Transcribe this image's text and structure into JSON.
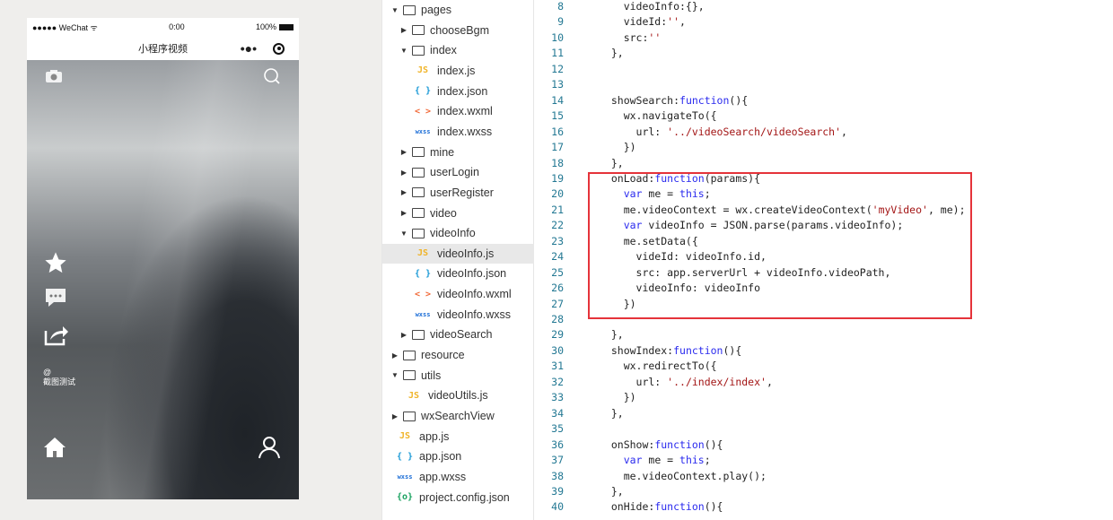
{
  "phone": {
    "status": {
      "carrier": "●●●●● WeChat",
      "wifi": "ᯤ",
      "time": "0:00",
      "battery": "100%"
    },
    "nav": {
      "title": "小程序视频",
      "more": "•●•"
    },
    "overlay": {
      "at": "@",
      "username": "截图测试"
    },
    "icons": [
      "camera-icon",
      "search-icon",
      "star-icon",
      "comment-icon",
      "share-icon",
      "home-icon",
      "user-icon"
    ]
  },
  "tree": [
    {
      "label": "pages",
      "type": "folder",
      "open": true,
      "depth": 0
    },
    {
      "label": "chooseBgm",
      "type": "folder",
      "open": false,
      "depth": 1
    },
    {
      "label": "index",
      "type": "folder",
      "open": true,
      "depth": 1
    },
    {
      "label": "index.js",
      "type": "js",
      "depth": 2
    },
    {
      "label": "index.json",
      "type": "json",
      "depth": 2
    },
    {
      "label": "index.wxml",
      "type": "wxml",
      "depth": 2
    },
    {
      "label": "index.wxss",
      "type": "wxss",
      "depth": 2
    },
    {
      "label": "mine",
      "type": "folder",
      "open": false,
      "depth": 1
    },
    {
      "label": "userLogin",
      "type": "folder",
      "open": false,
      "depth": 1
    },
    {
      "label": "userRegister",
      "type": "folder",
      "open": false,
      "depth": 1
    },
    {
      "label": "video",
      "type": "folder",
      "open": false,
      "depth": 1
    },
    {
      "label": "videoInfo",
      "type": "folder",
      "open": true,
      "depth": 1
    },
    {
      "label": "videoInfo.js",
      "type": "js",
      "depth": 2,
      "selected": true
    },
    {
      "label": "videoInfo.json",
      "type": "json",
      "depth": 2
    },
    {
      "label": "videoInfo.wxml",
      "type": "wxml",
      "depth": 2
    },
    {
      "label": "videoInfo.wxss",
      "type": "wxss",
      "depth": 2
    },
    {
      "label": "videoSearch",
      "type": "folder",
      "open": false,
      "depth": 1
    },
    {
      "label": "resource",
      "type": "folder",
      "open": false,
      "depth": 0
    },
    {
      "label": "utils",
      "type": "folder",
      "open": true,
      "depth": 0
    },
    {
      "label": "videoUtils.js",
      "type": "js",
      "depth": 1
    },
    {
      "label": "wxSearchView",
      "type": "folder",
      "open": false,
      "depth": 0
    },
    {
      "label": "app.js",
      "type": "js",
      "depth": 0
    },
    {
      "label": "app.json",
      "type": "json",
      "depth": 0
    },
    {
      "label": "app.wxss",
      "type": "wxss",
      "depth": 0
    },
    {
      "label": "project.config.json",
      "type": "config",
      "depth": 0
    }
  ],
  "icon_glyphs": {
    "js": "JS",
    "json": "{ }",
    "wxml": "< >",
    "wxss": "wxss",
    "config": "{o}"
  },
  "icon_colors": {
    "js": "#f0b429",
    "json": "#1e9bd7",
    "wxml": "#f26b3a",
    "wxss": "#1e6fd7",
    "config": "#1aa260"
  },
  "highlight": {
    "from_line": 19,
    "to_line": 27,
    "color": "#e5333a"
  },
  "code": [
    {
      "n": "8",
      "t": [
        [
          "    videoInfo:{},",
          ""
        ]
      ]
    },
    {
      "n": "9",
      "t": [
        [
          "    videId:",
          ""
        ],
        [
          "''",
          "str"
        ],
        [
          ",",
          ""
        ]
      ]
    },
    {
      "n": "10",
      "t": [
        [
          "    src:",
          ""
        ],
        [
          "''",
          "str"
        ]
      ]
    },
    {
      "n": "11",
      "t": [
        [
          "  },",
          ""
        ]
      ]
    },
    {
      "n": "12",
      "t": []
    },
    {
      "n": "13",
      "t": []
    },
    {
      "n": "14",
      "t": [
        [
          "  showSearch:",
          ""
        ],
        [
          "function",
          "kw"
        ],
        [
          "(){",
          ""
        ]
      ]
    },
    {
      "n": "15",
      "t": [
        [
          "    wx.navigateTo({",
          ""
        ]
      ]
    },
    {
      "n": "16",
      "t": [
        [
          "      url: ",
          ""
        ],
        [
          "'../videoSearch/videoSearch'",
          "str"
        ],
        [
          ",",
          ""
        ]
      ]
    },
    {
      "n": "17",
      "t": [
        [
          "    })",
          ""
        ]
      ]
    },
    {
      "n": "18",
      "t": [
        [
          "  },",
          ""
        ]
      ]
    },
    {
      "n": "19",
      "t": [
        [
          "  onLoad:",
          ""
        ],
        [
          "function",
          "kw"
        ],
        [
          "(params){",
          ""
        ]
      ]
    },
    {
      "n": "20",
      "t": [
        [
          "    ",
          ""
        ],
        [
          "var",
          "kw"
        ],
        [
          " me = ",
          ""
        ],
        [
          "this",
          "kw"
        ],
        [
          ";",
          ""
        ]
      ]
    },
    {
      "n": "21",
      "t": [
        [
          "    me.videoContext = wx.createVideoContext(",
          ""
        ],
        [
          "'myVideo'",
          "str"
        ],
        [
          ", me);",
          ""
        ]
      ]
    },
    {
      "n": "22",
      "t": [
        [
          "    ",
          ""
        ],
        [
          "var",
          "kw"
        ],
        [
          " videoInfo = JSON.parse(params.videoInfo);",
          ""
        ]
      ]
    },
    {
      "n": "23",
      "t": [
        [
          "    me.setData({",
          ""
        ]
      ]
    },
    {
      "n": "24",
      "t": [
        [
          "      videId: videoInfo.id,",
          ""
        ]
      ]
    },
    {
      "n": "25",
      "t": [
        [
          "      src: app.serverUrl + videoInfo.videoPath,",
          ""
        ]
      ]
    },
    {
      "n": "26",
      "t": [
        [
          "      videoInfo: videoInfo",
          ""
        ]
      ]
    },
    {
      "n": "27",
      "t": [
        [
          "    })",
          ""
        ]
      ]
    },
    {
      "n": "28",
      "t": []
    },
    {
      "n": "29",
      "t": [
        [
          "  },",
          ""
        ]
      ]
    },
    {
      "n": "30",
      "t": [
        [
          "  showIndex:",
          ""
        ],
        [
          "function",
          "kw"
        ],
        [
          "(){",
          ""
        ]
      ]
    },
    {
      "n": "31",
      "t": [
        [
          "    wx.redirectTo({",
          ""
        ]
      ]
    },
    {
      "n": "32",
      "t": [
        [
          "      url: ",
          ""
        ],
        [
          "'../index/index'",
          "str"
        ],
        [
          ",",
          ""
        ]
      ]
    },
    {
      "n": "33",
      "t": [
        [
          "    })",
          ""
        ]
      ]
    },
    {
      "n": "34",
      "t": [
        [
          "  },",
          ""
        ]
      ]
    },
    {
      "n": "35",
      "t": []
    },
    {
      "n": "36",
      "t": [
        [
          "  onShow:",
          ""
        ],
        [
          "function",
          "kw"
        ],
        [
          "(){",
          ""
        ]
      ]
    },
    {
      "n": "37",
      "t": [
        [
          "    ",
          ""
        ],
        [
          "var",
          "kw"
        ],
        [
          " me = ",
          ""
        ],
        [
          "this",
          "kw"
        ],
        [
          ";",
          ""
        ]
      ]
    },
    {
      "n": "38",
      "t": [
        [
          "    me.videoContext.play();",
          ""
        ]
      ]
    },
    {
      "n": "39",
      "t": [
        [
          "  },",
          ""
        ]
      ]
    },
    {
      "n": "40",
      "t": [
        [
          "  onHide:",
          ""
        ],
        [
          "function",
          "kw"
        ],
        [
          "(){",
          ""
        ]
      ]
    }
  ]
}
